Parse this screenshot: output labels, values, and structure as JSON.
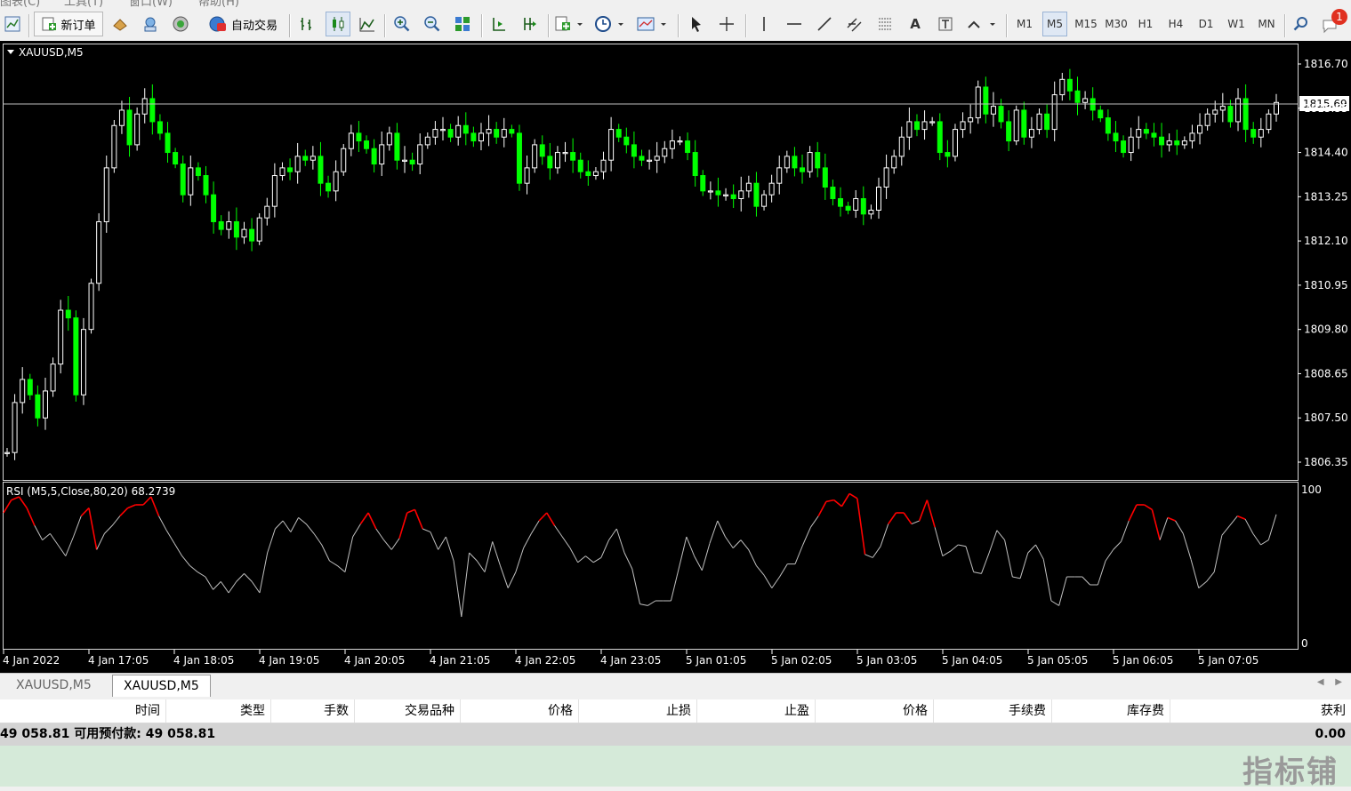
{
  "menu": [
    "图表(C)",
    "工具(T)",
    "窗口(W)",
    "帮助(H)"
  ],
  "toolbar": {
    "new_order": "新订单",
    "auto_trading": "自动交易",
    "timeframes": [
      "M1",
      "M5",
      "M15",
      "M30",
      "H1",
      "H4",
      "D1",
      "W1",
      "MN"
    ],
    "active_timeframe": "M5",
    "notification_count": "1"
  },
  "chart": {
    "title": "XAUUSD,M5",
    "current_price": "1815.69",
    "price_labels": [
      "1816.70",
      "1815.55",
      "1814.40",
      "1813.25",
      "1812.10",
      "1810.95",
      "1809.80",
      "1808.65",
      "1807.50",
      "1806.35"
    ],
    "time_labels": [
      "4 Jan 2022",
      "4 Jan 17:05",
      "4 Jan 18:05",
      "4 Jan 19:05",
      "4 Jan 20:05",
      "4 Jan 21:05",
      "4 Jan 22:05",
      "4 Jan 23:05",
      "5 Jan 01:05",
      "5 Jan 02:05",
      "5 Jan 03:05",
      "5 Jan 04:05",
      "5 Jan 05:05",
      "5 Jan 06:05",
      "5 Jan 07:05"
    ],
    "indicator_title": "RSI (M5,5,Close,80,20) 68.2739",
    "indicator_max": "100",
    "indicator_min": "0",
    "colors": {
      "bull": "#ffffff",
      "bear": "#00ff00",
      "overbought": "#ff0000",
      "oversold": "#00c000",
      "rsi_line": "#c0c0c0"
    }
  },
  "chart_data": {
    "type": "candlestick",
    "symbol": "XAUUSD",
    "timeframe": "M5",
    "ylim": [
      1806.0,
      1817.3
    ],
    "start_value": 1806.6,
    "closes": [
      1806.6,
      1807.9,
      1808.5,
      1808.1,
      1807.5,
      1808.2,
      1808.9,
      1810.3,
      1810.1,
      1808.1,
      1809.8,
      1811.0,
      1812.6,
      1814.0,
      1815.1,
      1815.5,
      1814.6,
      1815.4,
      1815.8,
      1815.2,
      1814.9,
      1814.4,
      1814.1,
      1813.3,
      1814.0,
      1813.8,
      1813.3,
      1812.6,
      1812.4,
      1812.6,
      1812.2,
      1812.4,
      1812.1,
      1812.7,
      1813.0,
      1813.8,
      1814.0,
      1813.9,
      1814.3,
      1814.2,
      1814.3,
      1813.6,
      1813.4,
      1813.9,
      1814.5,
      1814.9,
      1814.7,
      1814.5,
      1814.1,
      1814.6,
      1814.9,
      1814.2,
      1814.2,
      1814.1,
      1814.6,
      1814.8,
      1815.0,
      1815.0,
      1814.8,
      1815.1,
      1814.9,
      1814.7,
      1814.9,
      1815.0,
      1814.8,
      1815.0,
      1814.9,
      1813.6,
      1814.0,
      1814.6,
      1814.3,
      1814.0,
      1814.4,
      1814.4,
      1814.2,
      1813.9,
      1813.8,
      1813.9,
      1814.2,
      1815.0,
      1814.8,
      1814.6,
      1814.3,
      1814.2,
      1814.2,
      1814.3,
      1814.5,
      1814.7,
      1814.7,
      1814.4,
      1813.8,
      1813.4,
      1813.4,
      1813.3,
      1813.3,
      1813.2,
      1813.4,
      1813.6,
      1813.0,
      1813.3,
      1813.6,
      1814.0,
      1814.3,
      1814.0,
      1813.9,
      1814.4,
      1814.0,
      1813.5,
      1813.2,
      1813.0,
      1812.9,
      1813.2,
      1812.8,
      1812.9,
      1813.5,
      1814.0,
      1814.3,
      1814.8,
      1815.2,
      1815.0,
      1815.2,
      1815.2,
      1814.4,
      1814.3,
      1815.0,
      1815.2,
      1815.3,
      1816.1,
      1815.4,
      1815.6,
      1815.2,
      1814.7,
      1815.5,
      1814.8,
      1815.0,
      1815.4,
      1815.0,
      1815.9,
      1816.3,
      1816.0,
      1815.7,
      1815.8,
      1815.5,
      1815.3,
      1814.9,
      1814.7,
      1814.4,
      1814.8,
      1815.0,
      1814.9,
      1814.8,
      1814.6,
      1814.7,
      1814.6,
      1814.7,
      1814.9,
      1815.1,
      1815.4,
      1815.5,
      1815.6,
      1815.2,
      1815.8,
      1815.0,
      1814.8,
      1815.0,
      1815.4,
      1815.7
    ],
    "rsi": [
      85,
      93,
      95,
      88,
      77,
      68,
      72,
      65,
      58,
      70,
      83,
      88,
      62,
      72,
      77,
      83,
      88,
      90,
      90,
      95,
      83,
      74,
      66,
      58,
      52,
      48,
      45,
      37,
      42,
      35,
      42,
      47,
      42,
      35,
      60,
      75,
      80,
      73,
      82,
      78,
      72,
      65,
      55,
      52,
      48,
      70,
      78,
      85,
      75,
      68,
      62,
      69,
      85,
      87,
      75,
      73,
      62,
      70,
      55,
      20,
      60,
      55,
      48,
      67,
      52,
      38,
      48,
      63,
      72,
      80,
      85,
      77,
      70,
      63,
      54,
      58,
      54,
      57,
      68,
      75,
      60,
      50,
      28,
      27,
      30,
      30,
      30,
      50,
      70,
      58,
      49,
      66,
      80,
      70,
      63,
      68,
      62,
      52,
      46,
      38,
      45,
      53,
      53,
      65,
      76,
      83,
      92,
      93,
      89,
      97,
      94,
      59,
      57,
      64,
      78,
      85,
      85,
      78,
      80,
      93,
      76,
      58,
      61,
      65,
      64,
      48,
      47,
      60,
      74,
      68,
      45,
      44,
      60,
      65,
      56,
      30,
      27,
      45,
      45,
      45,
      40,
      40,
      55,
      62,
      67,
      80,
      90,
      90,
      87,
      68,
      82,
      80,
      72,
      56,
      38,
      42,
      48,
      71,
      77,
      83,
      81,
      72,
      65,
      68,
      84
    ]
  }
}
